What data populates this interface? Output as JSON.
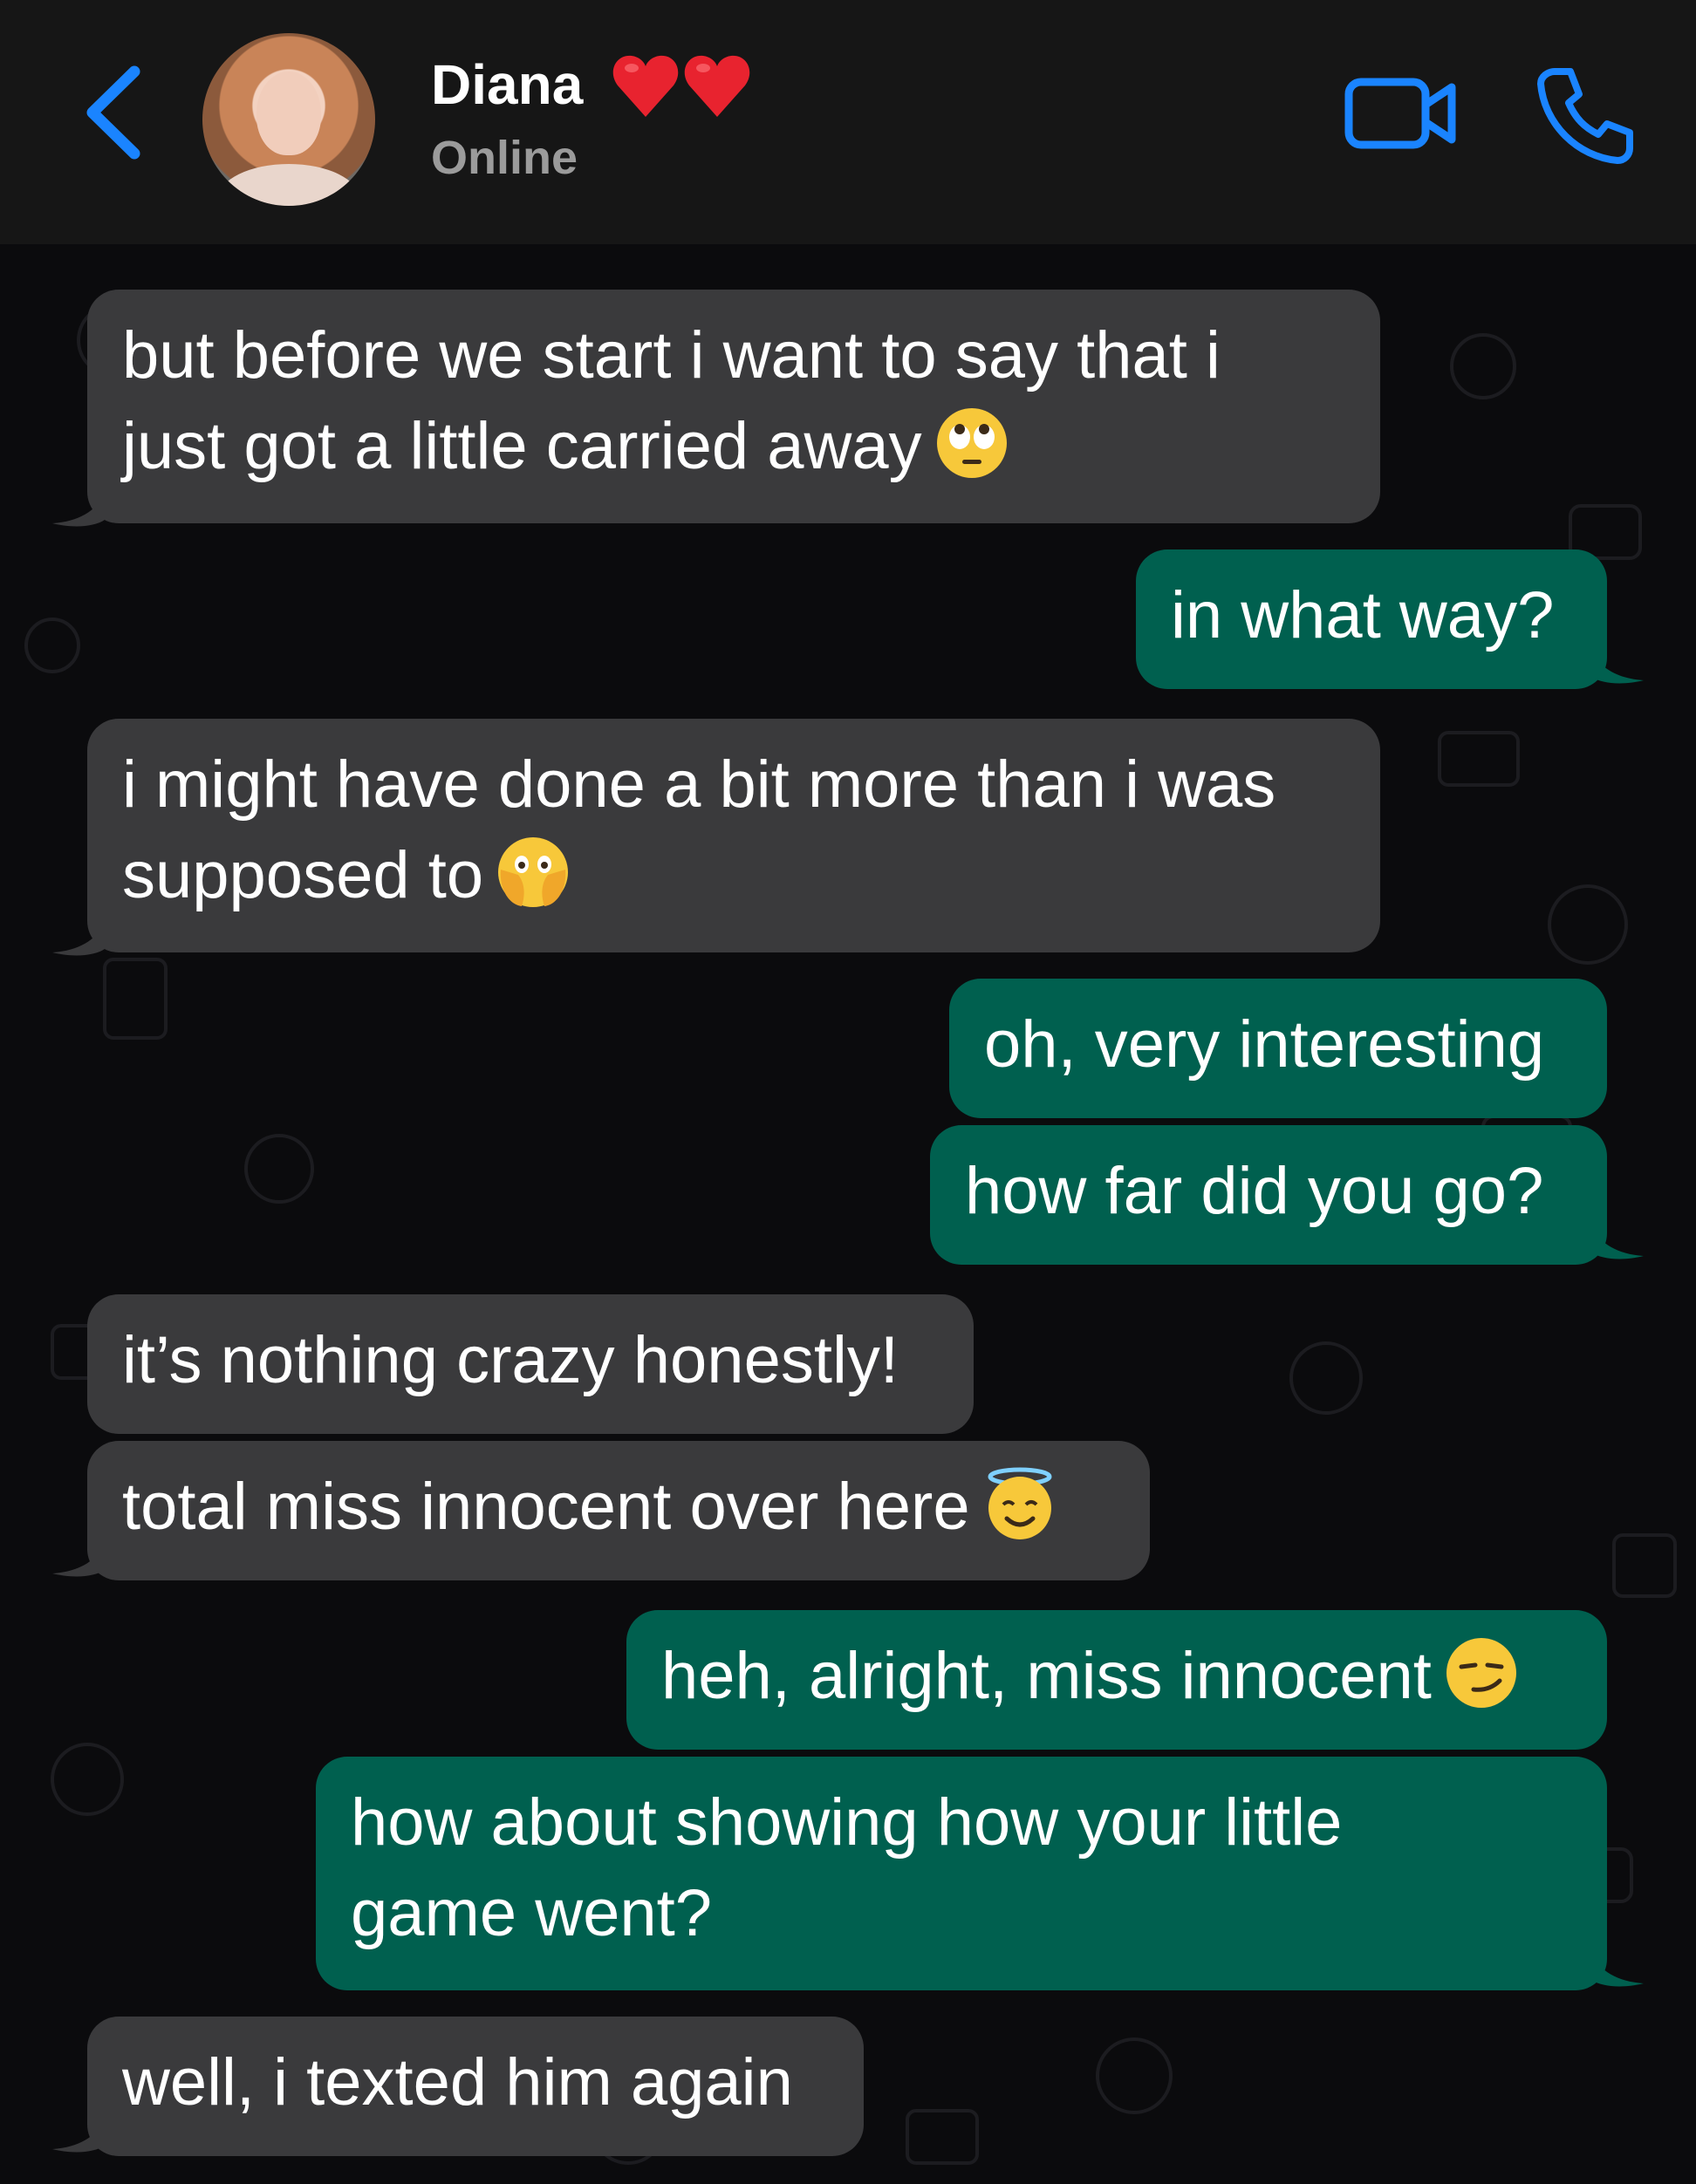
{
  "header": {
    "contact_name": "Diana",
    "status": "Online",
    "back_icon": "chevron-left-icon",
    "video_icon": "video-camera-icon",
    "call_icon": "phone-icon",
    "accent_color": "#1a84ff"
  },
  "messages": [
    {
      "direction": "incoming",
      "lines": [
        "but before we start i want to say that i",
        "just got a little carried away"
      ],
      "emoji": "face-with-rolling-eyes"
    },
    {
      "direction": "outgoing",
      "lines": [
        "in what way?"
      ]
    },
    {
      "direction": "incoming",
      "lines": [
        "i might have done a bit more than i was",
        "supposed to"
      ],
      "emoji": "face-with-open-eyes-and-hand-over-mouth"
    },
    {
      "direction": "outgoing",
      "lines": [
        "oh, very interesting"
      ]
    },
    {
      "direction": "outgoing",
      "lines": [
        "how far did you go?"
      ]
    },
    {
      "direction": "incoming",
      "lines": [
        "it’s nothing crazy honestly!"
      ]
    },
    {
      "direction": "incoming",
      "lines": [
        "total miss innocent over here"
      ],
      "emoji": "smiling-face-with-halo"
    },
    {
      "direction": "outgoing",
      "lines": [
        "heh, alright, miss innocent"
      ],
      "emoji": "smirking-face"
    },
    {
      "direction": "outgoing",
      "lines": [
        "how about showing how your little",
        "game went?"
      ]
    },
    {
      "direction": "incoming",
      "lines": [
        "well, i texted him again"
      ]
    }
  ],
  "colors": {
    "incoming_bubble": "#3a3a3c",
    "outgoing_bubble": "#00604f",
    "header_bg": "#161616",
    "chat_bg": "#0b0b0d"
  }
}
